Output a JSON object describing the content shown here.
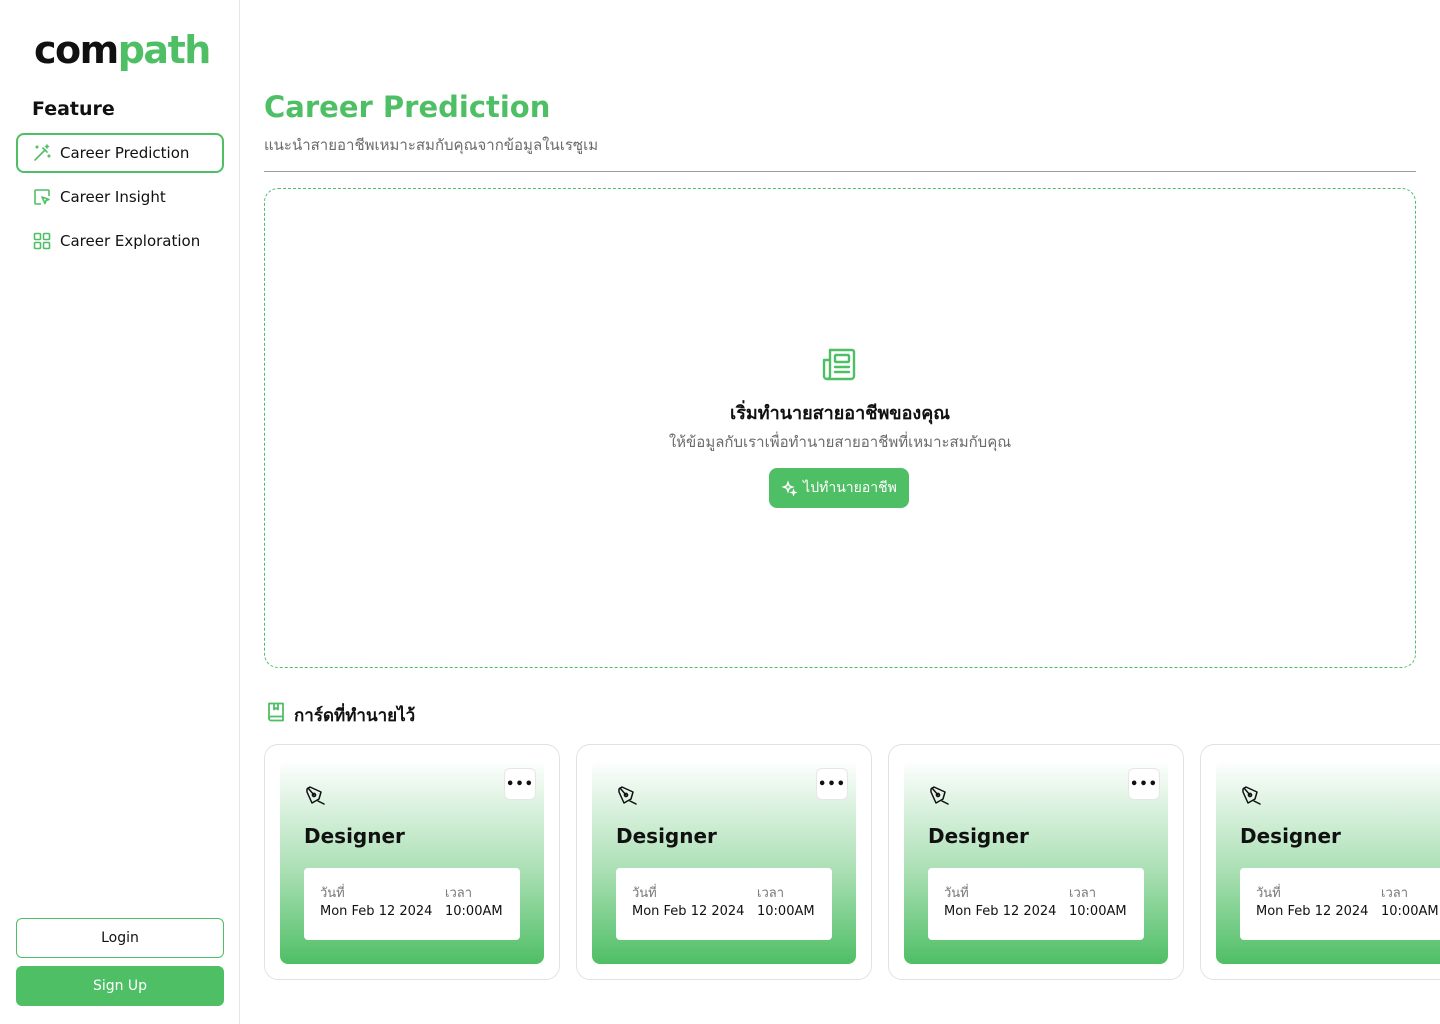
{
  "brand": {
    "logo_part1": "com",
    "logo_part2": "path",
    "accent": "#4fbf65"
  },
  "sidebar": {
    "heading": "Feature",
    "items": [
      {
        "label": "Career Prediction",
        "icon": "magic-wand-icon",
        "active": true
      },
      {
        "label": "Career Insight",
        "icon": "cursor-square-icon",
        "active": false
      },
      {
        "label": "Career Exploration",
        "icon": "grid-icon",
        "active": false
      }
    ],
    "login_label": "Login",
    "signup_label": "Sign Up"
  },
  "main": {
    "title": "Career Prediction",
    "subtitle": "แนะนำสายอาชีพเหมาะสมกับคุณจากข้อมูลในเรซูเม",
    "empty_state": {
      "icon": "newspaper-icon",
      "title": "เริ่มทำนายสายอาชีพของคุณ",
      "subtitle": "ให้ข้อมูลกับเราเพื่อทำนายสายอาชีพที่เหมาะสมกับคุณ",
      "button_label": "ไปทำนายอาชีพ",
      "button_icon": "sparkle-icon"
    },
    "saved_section": {
      "icon": "bookmark-book-icon",
      "title": "การ์ดที่ทำนายไว้",
      "cards": [
        {
          "role": "Designer",
          "date_label": "วันที่",
          "date": "Mon Feb 12 2024",
          "time_label": "เวลา",
          "time": "10:00AM",
          "more_label": "•••"
        },
        {
          "role": "Designer",
          "date_label": "วันที่",
          "date": "Mon Feb 12 2024",
          "time_label": "เวลา",
          "time": "10:00AM",
          "more_label": "•••"
        },
        {
          "role": "Designer",
          "date_label": "วันที่",
          "date": "Mon Feb 12 2024",
          "time_label": "เวลา",
          "time": "10:00AM",
          "more_label": "•••"
        },
        {
          "role": "Designer",
          "date_label": "วันที่",
          "date": "Mon Feb 12 2024",
          "time_label": "เวลา",
          "time": "10:00AM",
          "more_label": "•••"
        }
      ]
    }
  }
}
